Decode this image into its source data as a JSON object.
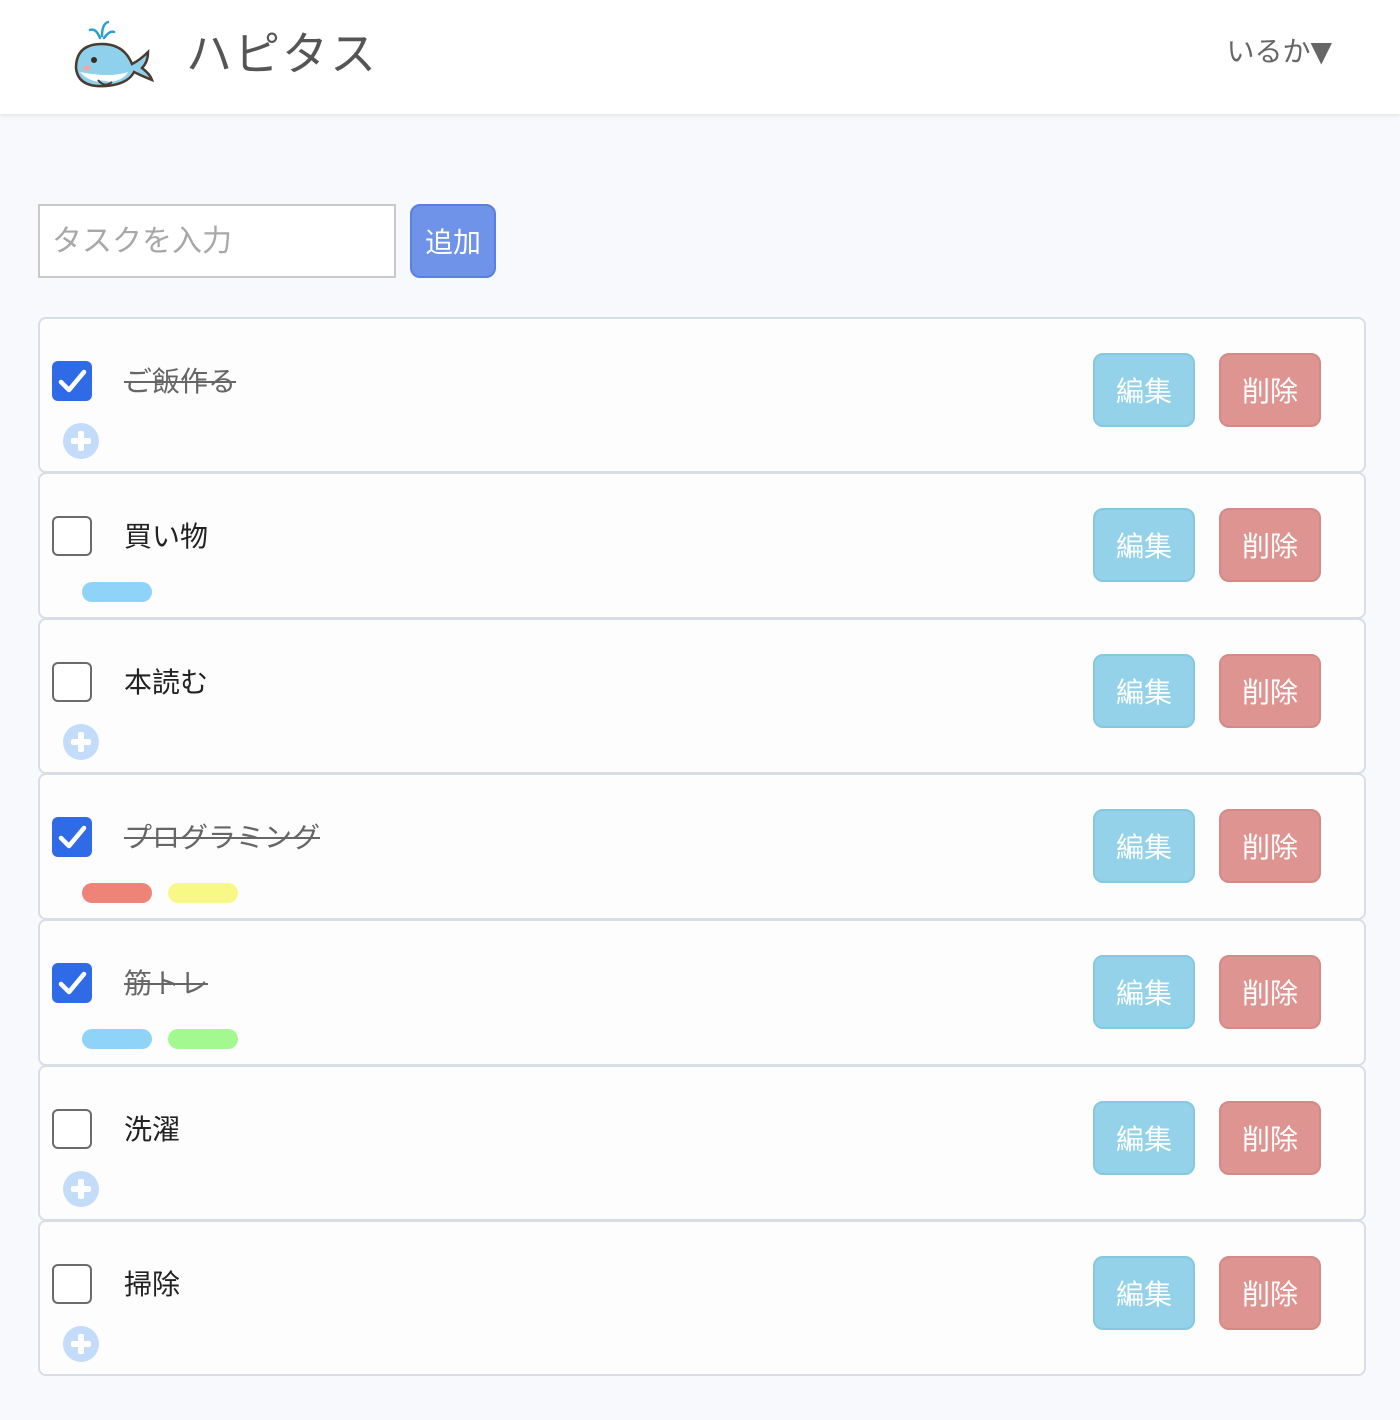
{
  "header": {
    "app_title": "ハピタス",
    "user_menu": "いるか▼"
  },
  "task_form": {
    "input_placeholder": "タスクを入力",
    "input_value": "",
    "add_label": "追加"
  },
  "tasks": [
    {
      "name": "ご飯作る",
      "done": true,
      "tags": []
    },
    {
      "name": "買い物",
      "done": false,
      "tags": [
        "#90d3f8"
      ]
    },
    {
      "name": "本読む",
      "done": false,
      "tags": []
    },
    {
      "name": "プログラミング",
      "done": true,
      "tags": [
        "#f08378",
        "#f8f887"
      ]
    },
    {
      "name": "筋トレ",
      "done": true,
      "tags": [
        "#90d3f8",
        "#a3f890"
      ]
    },
    {
      "name": "洗濯",
      "done": false,
      "tags": []
    },
    {
      "name": "掃除",
      "done": false,
      "tags": []
    }
  ],
  "task_actions": {
    "edit_label": "編集",
    "delete_label": "削除"
  },
  "colors": {
    "accent": "#6f93e8",
    "checkbox_checked": "#2f6be6",
    "edit_button": "#93d2e8",
    "delete_button": "#de9490",
    "add_tag_icon": "#c3dcfa"
  },
  "icons": {
    "logo": "whale-icon",
    "add_tag": "plus-circle-icon",
    "check": "check-icon"
  }
}
